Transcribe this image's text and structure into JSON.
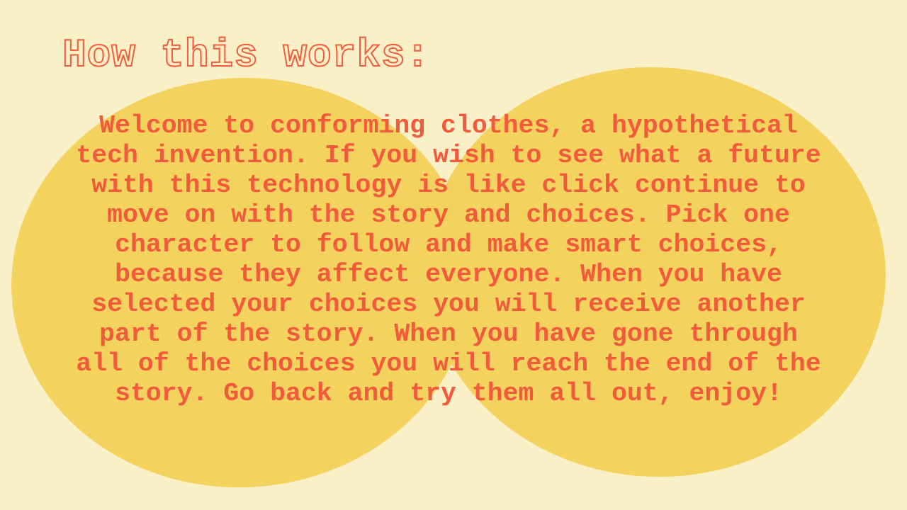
{
  "slide": {
    "title": "How this works:",
    "body": "Welcome to conforming clothes, a hypothetical tech invention. If you wish to see what a future with this technology is like click continue to move on with the story and choices. Pick one character to follow and make smart choices, because they affect everyone. When you have selected your choices you will receive another part of the story. When you have gone through all of the choices you will reach the end of the story. Go back and try them all out, enjoy!"
  },
  "colors": {
    "background": "#faf0c8",
    "blob": "#f3d35e",
    "text": "#f15a3a"
  }
}
